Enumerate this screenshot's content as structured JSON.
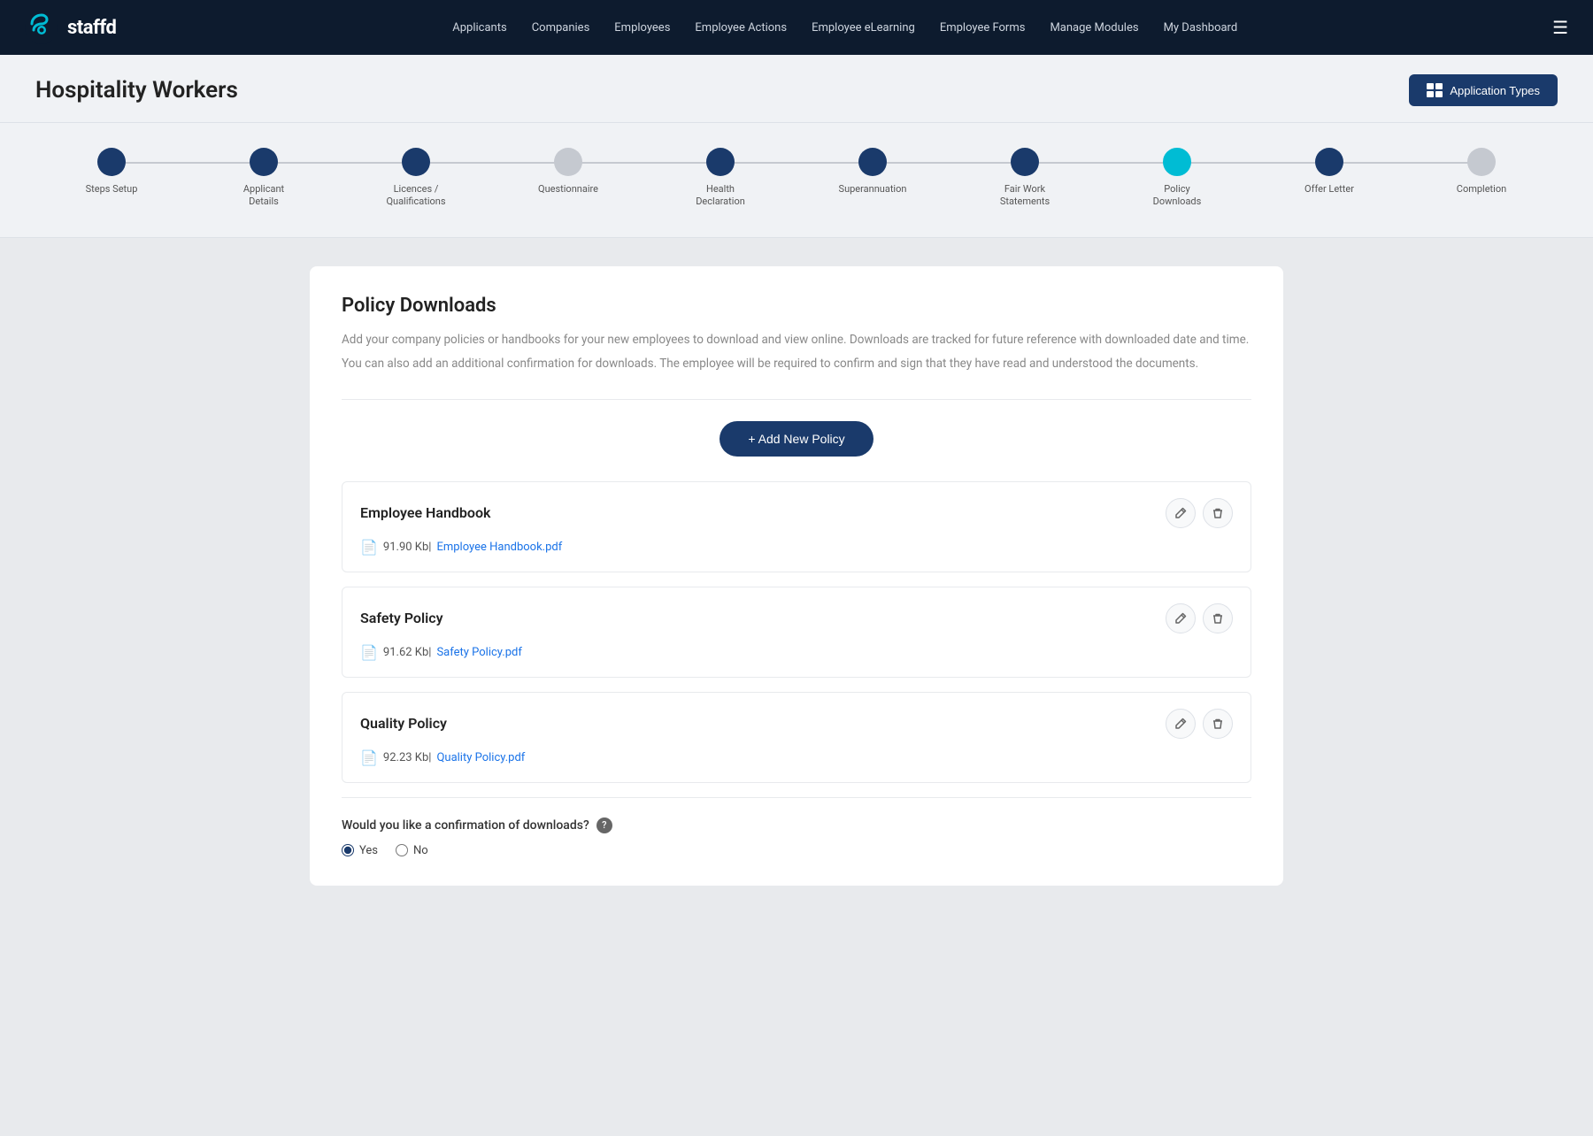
{
  "navbar": {
    "logo_text": "staffd",
    "links": [
      {
        "label": "Applicants",
        "id": "applicants"
      },
      {
        "label": "Companies",
        "id": "companies"
      },
      {
        "label": "Employees",
        "id": "employees"
      },
      {
        "label": "Employee Actions",
        "id": "employee-actions"
      },
      {
        "label": "Employee eLearning",
        "id": "employee-elearning"
      },
      {
        "label": "Employee Forms",
        "id": "employee-forms"
      },
      {
        "label": "Manage Modules",
        "id": "manage-modules"
      },
      {
        "label": "My Dashboard",
        "id": "my-dashboard"
      }
    ]
  },
  "header": {
    "title": "Hospitality Workers",
    "app_types_btn": "Application Types"
  },
  "stepper": {
    "steps": [
      {
        "label": "Steps Setup",
        "state": "completed"
      },
      {
        "label": "Applicant Details",
        "state": "completed"
      },
      {
        "label": "Licences / Qualifications",
        "state": "completed"
      },
      {
        "label": "Questionnaire",
        "state": "inactive"
      },
      {
        "label": "Health Declaration",
        "state": "completed"
      },
      {
        "label": "Superannuation",
        "state": "completed"
      },
      {
        "label": "Fair Work Statements",
        "state": "completed"
      },
      {
        "label": "Policy Downloads",
        "state": "active"
      },
      {
        "label": "Offer Letter",
        "state": "completed"
      },
      {
        "label": "Completion",
        "state": "inactive"
      }
    ]
  },
  "content": {
    "title": "Policy Downloads",
    "description1": "Add your company policies or handbooks for your new employees to download and view online. Downloads are tracked for future reference with downloaded date and time.",
    "description2": "You can also add an additional confirmation for downloads. The employee will be required to confirm and sign that they have read and understood the documents.",
    "add_policy_btn": "+ Add New Policy",
    "policies": [
      {
        "name": "Employee Handbook",
        "file_size": "91.90 Kb",
        "file_name": "Employee Handbook.pdf"
      },
      {
        "name": "Safety Policy",
        "file_size": "91.62 Kb",
        "file_name": "Safety Policy.pdf"
      },
      {
        "name": "Quality Policy",
        "file_size": "92.23 Kb",
        "file_name": "Quality Policy.pdf"
      }
    ],
    "confirmation_question": "Would you like a confirmation of downloads?",
    "radio_yes": "Yes",
    "radio_no": "No"
  }
}
